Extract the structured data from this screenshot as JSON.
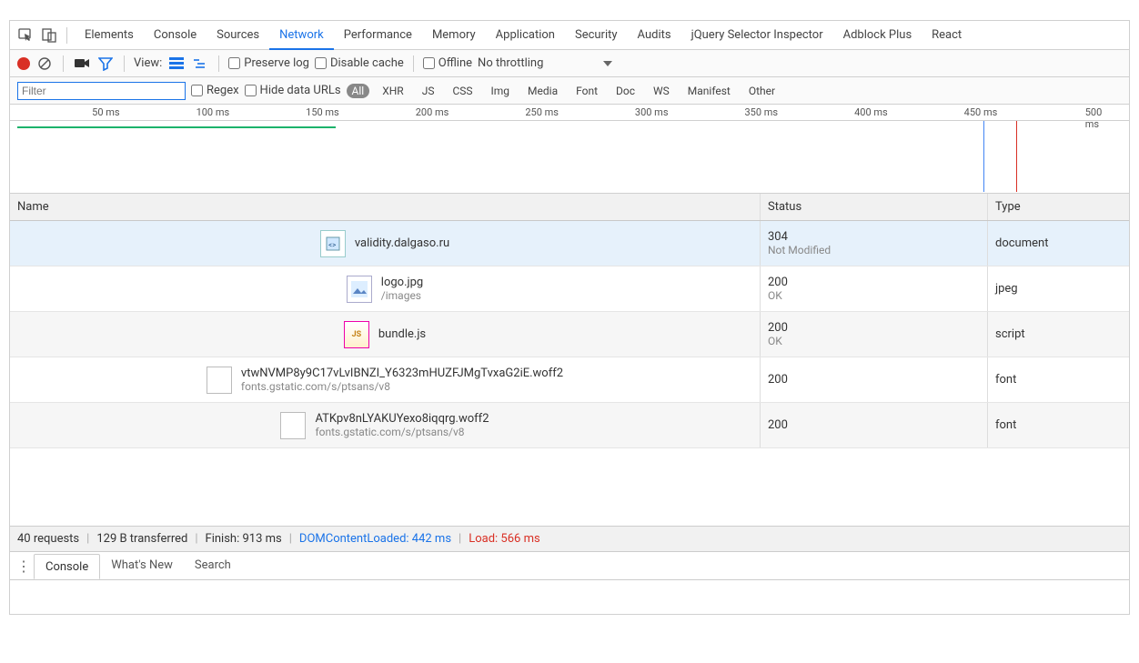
{
  "tabs": {
    "items": [
      "Elements",
      "Console",
      "Sources",
      "Network",
      "Performance",
      "Memory",
      "Application",
      "Security",
      "Audits",
      "jQuery Selector Inspector",
      "Adblock Plus",
      "React"
    ],
    "active": "Network"
  },
  "toolbar1": {
    "view_label": "View:",
    "preserve_log": "Preserve log",
    "disable_cache": "Disable cache",
    "offline": "Offline",
    "throttling": "No throttling"
  },
  "toolbar2": {
    "filter_placeholder": "Filter",
    "regex": "Regex",
    "hide_data_urls": "Hide data URLs",
    "types": [
      "All",
      "XHR",
      "JS",
      "CSS",
      "Img",
      "Media",
      "Font",
      "Doc",
      "WS",
      "Manifest",
      "Other"
    ],
    "active_type": "All"
  },
  "timeline": {
    "ticks": [
      "50 ms",
      "100 ms",
      "150 ms",
      "200 ms",
      "250 ms",
      "300 ms",
      "350 ms",
      "400 ms",
      "450 ms",
      "500 ms"
    ]
  },
  "table": {
    "headers": {
      "name": "Name",
      "status": "Status",
      "type": "Type"
    },
    "rows": [
      {
        "name": "validity.dalgaso.ru",
        "sub": "",
        "status": "304",
        "status_sub": "Not Modified",
        "type": "document",
        "icon": "doc",
        "selected": true
      },
      {
        "name": "logo.jpg",
        "sub": "/images",
        "status": "200",
        "status_sub": "OK",
        "type": "jpeg",
        "icon": "img"
      },
      {
        "name": "bundle.js",
        "sub": "",
        "status": "200",
        "status_sub": "OK",
        "type": "script",
        "icon": "js",
        "alt": true
      },
      {
        "name": "vtwNVMP8y9C17vLvIBNZI_Y6323mHUZFJMgTvxaG2iE.woff2",
        "sub": "fonts.gstatic.com/s/ptsans/v8",
        "status": "200",
        "status_sub": "",
        "type": "font",
        "icon": ""
      },
      {
        "name": "ATKpv8nLYAKUYexo8iqqrg.woff2",
        "sub": "fonts.gstatic.com/s/ptsans/v8",
        "status": "200",
        "status_sub": "",
        "type": "font",
        "icon": "",
        "alt": true
      }
    ]
  },
  "status": {
    "requests": "40 requests",
    "transferred": "129 B transferred",
    "finish": "Finish: 913 ms",
    "dcl": "DOMContentLoaded: 442 ms",
    "load": "Load: 566 ms"
  },
  "drawer": {
    "tabs": [
      "Console",
      "What's New",
      "Search"
    ],
    "active": "Console"
  }
}
